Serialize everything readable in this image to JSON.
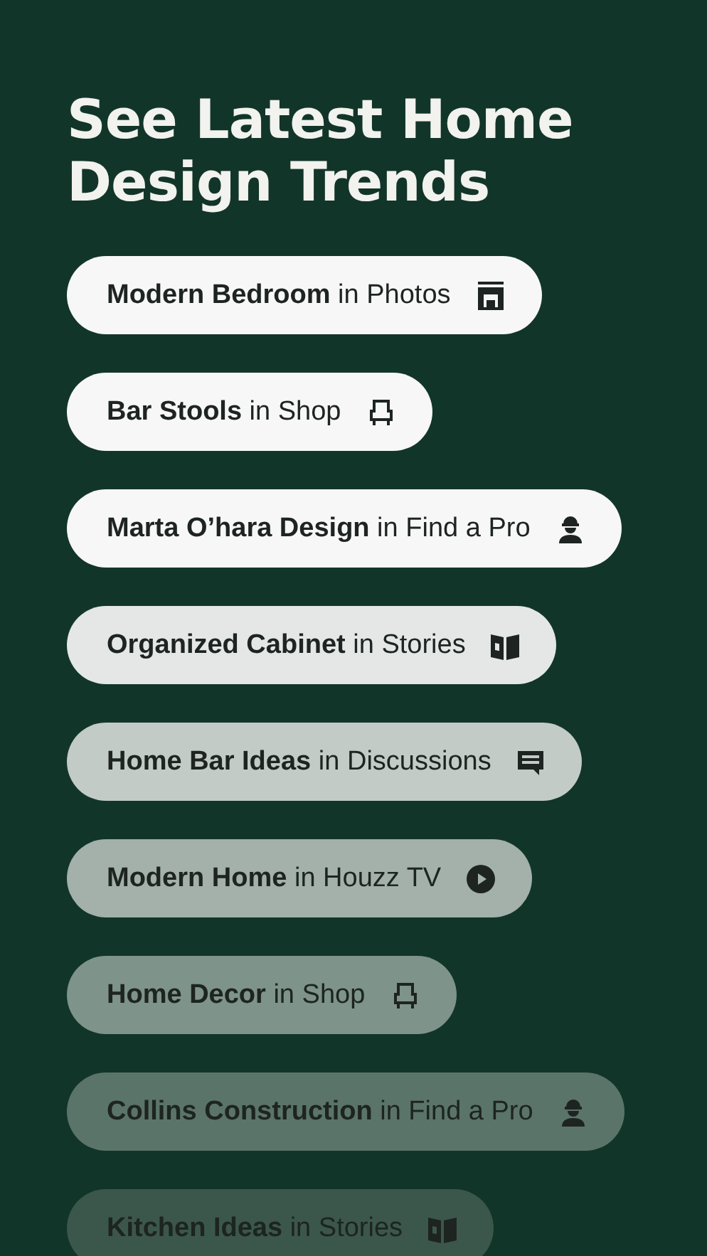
{
  "title": "See Latest Home Design Trends",
  "suggestions": [
    {
      "text": "**Modern Bedroom** in Photos",
      "kind": "photos"
    },
    {
      "text": "**Bar Stools** in Shop",
      "kind": "shop"
    },
    {
      "text": "**Marta O’hara Design** in Find a Pro",
      "kind": "pro"
    },
    {
      "text": "**Organized Cabinet** in Stories",
      "kind": "stories"
    },
    {
      "text": "**Home Bar Ideas** in Discussions",
      "kind": "discussions"
    },
    {
      "text": "**Modern Home** in Houzz TV",
      "kind": "tv"
    },
    {
      "text": "**Home Decor** in Shop",
      "kind": "shop"
    },
    {
      "text": "**Collins Construction** in Find a Pro",
      "kind": "pro"
    },
    {
      "text": "**Kitchen Ideas** in Stories",
      "kind": "stories"
    }
  ]
}
